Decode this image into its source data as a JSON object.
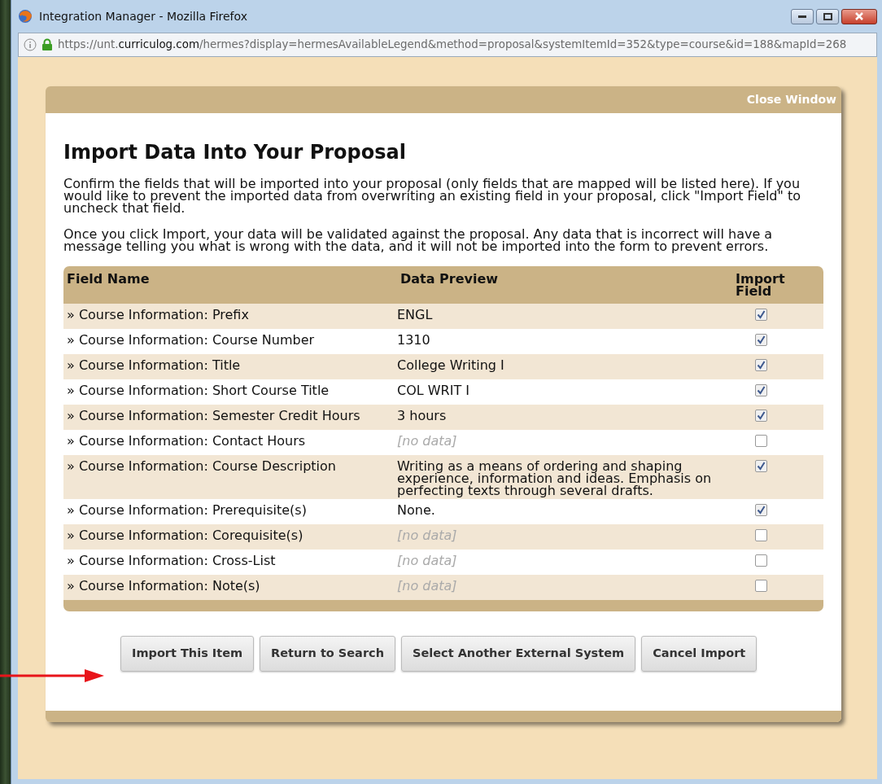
{
  "window": {
    "title": "Integration Manager - Mozilla Firefox"
  },
  "address_bar": {
    "url_start": "https://unt.",
    "url_domain": "curriculog.com",
    "url_rest": "/hermes?display=hermesAvailableLegend&method=proposal&systemItemId=352&type=course&id=188&mapId=268"
  },
  "dialog": {
    "close_link": "Close Window",
    "heading": "Import Data Into Your Proposal",
    "paragraphs": [
      "Confirm the fields that will be imported into your proposal (only fields that are mapped will be listed here). If you would like to prevent the imported data from overwriting an existing field in your proposal, click \"Import Field\" to uncheck that field.",
      "Once you click Import, your data will be validated against the proposal. Any data that is incorrect will have a message telling you what is wrong with the data, and it will not be imported into the form to prevent errors."
    ],
    "table": {
      "columns": [
        "Field Name",
        "Data Preview",
        "Import Field"
      ],
      "rows": [
        {
          "field": "» Course Information: Prefix",
          "preview": "ENGL",
          "no_data": false,
          "checked": true
        },
        {
          "field": "» Course Information: Course Number",
          "preview": "1310",
          "no_data": false,
          "checked": true
        },
        {
          "field": "» Course Information: Title",
          "preview": "College Writing I",
          "no_data": false,
          "checked": true
        },
        {
          "field": "» Course Information: Short Course Title",
          "preview": "COL WRIT I",
          "no_data": false,
          "checked": true
        },
        {
          "field": "» Course Information: Semester Credit Hours",
          "preview": "3 hours",
          "no_data": false,
          "checked": true
        },
        {
          "field": "» Course Information: Contact Hours",
          "preview": "[no data]",
          "no_data": true,
          "checked": false
        },
        {
          "field": "» Course Information: Course Description",
          "preview": "Writing as a means of ordering and shaping experience, information and ideas. Emphasis on perfecting texts through several drafts.",
          "no_data": false,
          "checked": true
        },
        {
          "field": "» Course Information: Prerequisite(s)",
          "preview": "None.",
          "no_data": false,
          "checked": true
        },
        {
          "field": "» Course Information: Corequisite(s)",
          "preview": "[no data]",
          "no_data": true,
          "checked": false
        },
        {
          "field": "» Course Information: Cross-List",
          "preview": "[no data]",
          "no_data": true,
          "checked": false
        },
        {
          "field": "» Course Information: Note(s)",
          "preview": "[no data]",
          "no_data": true,
          "checked": false
        }
      ]
    },
    "buttons": [
      "Import This Item",
      "Return to Search",
      "Select Another External System",
      "Cancel Import"
    ]
  }
}
